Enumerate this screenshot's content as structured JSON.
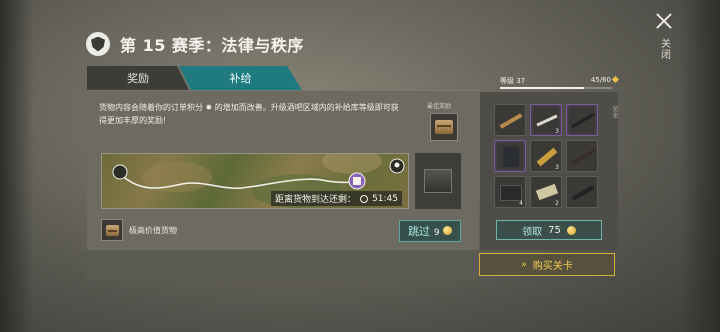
{
  "close": {
    "label": "关闭"
  },
  "header": {
    "title": "第 15 赛季：法律与秩序"
  },
  "tabs": [
    {
      "label": "奖励",
      "active": false
    },
    {
      "label": "补给",
      "active": true
    }
  ],
  "main": {
    "description": "货物内容会随着你的订单积分 ✹ 的增加而改善。升级酒吧区域内的补给库等级即可获得更加丰厚的奖励!",
    "best_reward_label": "最佳奖励",
    "countdown_label": "距离货物到达还剩：",
    "countdown_time": "51:45",
    "high_value_label": "极高价值货物",
    "skip_label": "跳过",
    "skip_cost": "9"
  },
  "level": {
    "label": "等级 37",
    "progress_text": "45/60",
    "progress_fraction": 0.75
  },
  "rewards": {
    "side_label": "奖金",
    "items": [
      {
        "icon": "rifle-icon",
        "qty": "",
        "rare": false
      },
      {
        "icon": "knife-icon",
        "qty": "3",
        "rare": true
      },
      {
        "icon": "sniper-rifle-icon",
        "qty": "",
        "rare": true
      },
      {
        "icon": "armor-vest-icon",
        "qty": "",
        "rare": true
      },
      {
        "icon": "ammo-belt-icon",
        "qty": "3",
        "rare": false
      },
      {
        "icon": "shotgun-icon",
        "qty": "",
        "rare": false
      },
      {
        "icon": "crate-icon",
        "qty": "4",
        "rare": false
      },
      {
        "icon": "cash-bundle-icon",
        "qty": "2",
        "rare": false
      },
      {
        "icon": "pistol-icon",
        "qty": "",
        "rare": false
      }
    ],
    "claim_label": "领取",
    "claim_cost": "75"
  },
  "buy": {
    "label": "购买关卡"
  },
  "colors": {
    "accent_teal": "#1f7b80",
    "gold": "#f2cf55",
    "rare_purple": "#7a5a9a"
  }
}
